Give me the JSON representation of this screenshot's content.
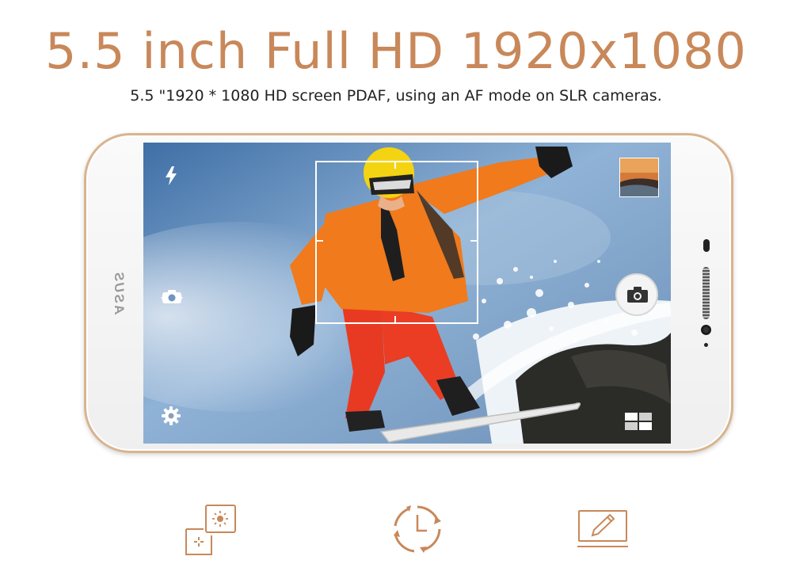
{
  "header": {
    "title": "5.5 inch Full HD 1920x1080",
    "subtitle": "5.5 \"1920 * 1080 HD screen PDAF, using an AF mode on SLR cameras."
  },
  "phone": {
    "brand": "ASUS"
  },
  "camera_ui": {
    "icons": [
      "flash-icon",
      "switch-camera-icon",
      "settings-icon",
      "gallery-thumbnail",
      "shutter-icon",
      "mode-grid-icon"
    ]
  },
  "features": {
    "icons": [
      "pdaf-focus-icon",
      "fast-capture-clock-icon",
      "screen-edit-icon"
    ]
  },
  "colors": {
    "accent": "#c8885a",
    "text": "#222222",
    "bezel": "#d9b48f"
  }
}
